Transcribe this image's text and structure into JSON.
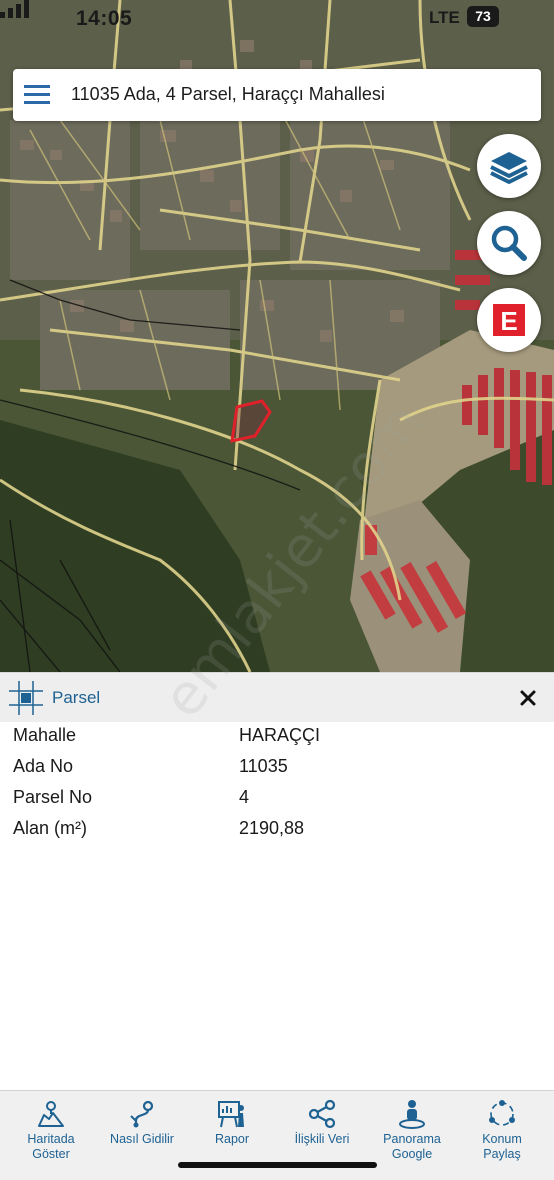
{
  "status_bar": {
    "time": "14:05",
    "network": "LTE",
    "battery": "73"
  },
  "search": {
    "text": "11035 Ada, 4 Parsel, Haraççı Mahallesi"
  },
  "map": {
    "buttons": [
      {
        "name": "layers",
        "icon": "layers-icon"
      },
      {
        "name": "search",
        "icon": "search-icon"
      },
      {
        "name": "e-button",
        "icon": "e-icon",
        "label": "E"
      }
    ],
    "watermark": "emlakjet.com",
    "colors": {
      "parcel_outline": "#e0202a",
      "roads": "#e3d690",
      "vegetation": "#3c4a2b"
    }
  },
  "panel": {
    "title": "Parsel",
    "rows": [
      {
        "label": "Mahalle",
        "value": "HARAÇÇI"
      },
      {
        "label": "Ada No",
        "value": "11035"
      },
      {
        "label": "Parsel No",
        "value": "4"
      },
      {
        "label": "Alan (m²)",
        "value": "2190,88"
      }
    ]
  },
  "bottom_nav": [
    {
      "label": "Haritada\nGöster",
      "icon": "map-pin-icon"
    },
    {
      "label": "Nasıl Gidilir",
      "icon": "route-icon"
    },
    {
      "label": "Rapor",
      "icon": "report-icon"
    },
    {
      "label": "İlişkili Veri",
      "icon": "share-icon"
    },
    {
      "label": "Panorama\nGoogle",
      "icon": "street-view-icon"
    },
    {
      "label": "Konum\nPaylaş",
      "icon": "location-share-icon"
    }
  ],
  "accent_color": "#1e6293"
}
